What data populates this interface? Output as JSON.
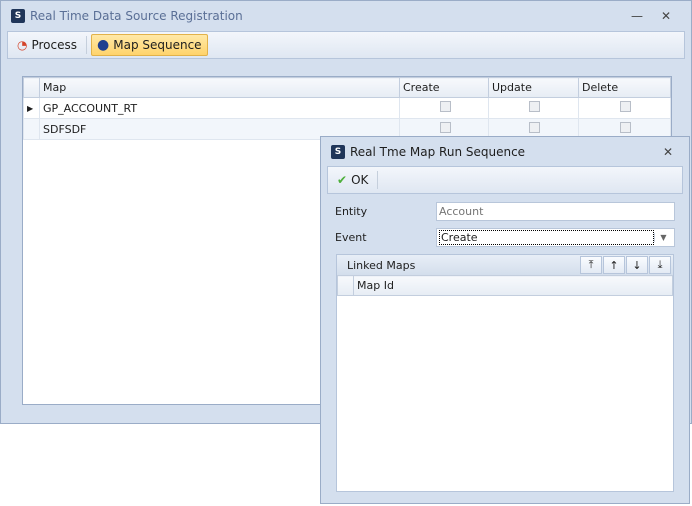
{
  "main": {
    "title": "Real Time Data Source Registration",
    "toolbar": {
      "process": "Process",
      "map_sequence": "Map Sequence"
    },
    "grid": {
      "columns": [
        "Map",
        "Create",
        "Update",
        "Delete"
      ],
      "rows": [
        {
          "map": "GP_ACCOUNT_RT"
        },
        {
          "map": "SDFSDF"
        }
      ]
    }
  },
  "dialog": {
    "title": "Real Tme Map Run Sequence",
    "ok": "OK",
    "entity_label": "Entity",
    "entity_placeholder": "Account",
    "event_label": "Event",
    "event_value": "Create",
    "linked_maps": {
      "title": "Linked Maps",
      "column": "Map Id",
      "buttons": [
        "move-top",
        "move-up",
        "move-down",
        "move-bottom"
      ]
    }
  }
}
